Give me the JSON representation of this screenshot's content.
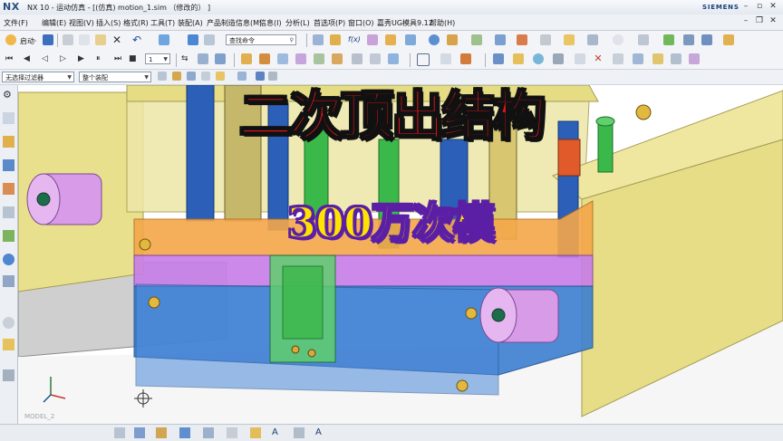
{
  "window": {
    "logo": "NX",
    "title": "NX 10 - 运动仿真 - [(仿真) motion_1.sim （修改的） ]",
    "brand": "SIEMENS"
  },
  "menu": {
    "items": [
      "文件(F)",
      "编辑(E)",
      "视图(V)",
      "插入(S)",
      "格式(R)",
      "工具(T)",
      "装配(A)",
      "产品制造信息(M)",
      "信息(I)",
      "分析(L)",
      "首选项(P)",
      "窗口(O)",
      "嘉秀UG模具9.12",
      "帮助(H)"
    ]
  },
  "toolbar": {
    "start_label": "启动·",
    "command_search_placeholder": "查找命令",
    "frame_value": "1"
  },
  "selection_bar": {
    "filter_value": "无选择过滤器",
    "scope_value": "整个装配"
  },
  "overlay": {
    "title": "二次顶出结构",
    "subtitle": "300万次模"
  },
  "viewport": {
    "view_label": "MODEL_2"
  },
  "colors": {
    "accent_red": "#e8141b",
    "accent_yellow": "#ffe400",
    "accent_purple": "#5b1fa6",
    "mold_yellow": "#e8e08c",
    "plate_orange": "#f4a74a",
    "plate_purple": "#c77de8",
    "plate_blue": "#3d7fd1",
    "pin_blue": "#2b5fb8",
    "guide_green": "#3bb84a",
    "bushing_violet": "#d79be8"
  }
}
